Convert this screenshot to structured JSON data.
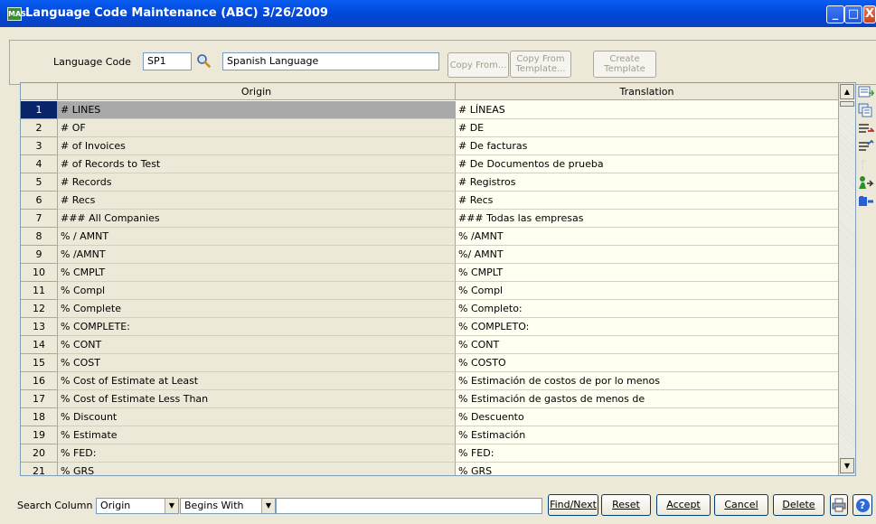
{
  "window": {
    "title": "Language Code Maintenance (ABC) 3/26/2009",
    "app_icon": "MAS",
    "minimize": "_",
    "maximize": "□",
    "close": "X"
  },
  "header": {
    "language_code_label": "Language Code",
    "language_code_value": "SP1",
    "description_value": "Spanish Language",
    "copy_from_label": "Copy From...",
    "copy_from_template_label": "Copy From Template...",
    "create_template_label": "Create Template"
  },
  "grid": {
    "columns": [
      "Origin",
      "Translation"
    ],
    "rows": [
      {
        "num": "1",
        "origin": "# LINES",
        "translation": "# LÍNEAS"
      },
      {
        "num": "2",
        "origin": "# OF",
        "translation": "# DE"
      },
      {
        "num": "3",
        "origin": "# of Invoices",
        "translation": "# De facturas"
      },
      {
        "num": "4",
        "origin": "# of Records to Test",
        "translation": "# De Documentos de prueba"
      },
      {
        "num": "5",
        "origin": "# Records",
        "translation": "# Registros"
      },
      {
        "num": "6",
        "origin": "# Recs",
        "translation": "# Recs"
      },
      {
        "num": "7",
        "origin": "### All Companies",
        "translation": "### Todas las empresas"
      },
      {
        "num": "8",
        "origin": "% / AMNT",
        "translation": "% /AMNT"
      },
      {
        "num": "9",
        "origin": "% /AMNT",
        "translation": "%/ AMNT"
      },
      {
        "num": "10",
        "origin": "% CMPLT",
        "translation": "% CMPLT"
      },
      {
        "num": "11",
        "origin": "% Compl",
        "translation": "% Compl"
      },
      {
        "num": "12",
        "origin": "% Complete",
        "translation": "% Completo:"
      },
      {
        "num": "13",
        "origin": "% COMPLETE:",
        "translation": "% COMPLETO:"
      },
      {
        "num": "14",
        "origin": "% CONT",
        "translation": "% CONT"
      },
      {
        "num": "15",
        "origin": "% COST",
        "translation": "% COSTO"
      },
      {
        "num": "16",
        "origin": "% Cost of Estimate at Least",
        "translation": "% Estimación de costos de por lo menos"
      },
      {
        "num": "17",
        "origin": "% Cost of Estimate Less Than",
        "translation": "% Estimación de gastos de menos de"
      },
      {
        "num": "18",
        "origin": "% Discount",
        "translation": "% Descuento"
      },
      {
        "num": "19",
        "origin": "% Estimate",
        "translation": "% Estimación"
      },
      {
        "num": "20",
        "origin": "% FED:",
        "translation": "% FED:"
      },
      {
        "num": "21",
        "origin": "% GRS",
        "translation": "% GRS"
      }
    ],
    "scroll_up": "▲",
    "scroll_down": "▼"
  },
  "footer": {
    "search_column_label": "Search Column",
    "search_column_value": "Origin",
    "search_mode_value": "Begins With",
    "search_text_value": "",
    "find_next_label": "Find/Next",
    "reset_label": "Reset",
    "accept_label": "Accept",
    "cancel_label": "Cancel",
    "delete_label": "Delete",
    "print_icon": "printer-icon",
    "help_icon": "help-icon",
    "help_glyph": "?"
  },
  "colors": {
    "title_bar": "#0047d5",
    "selected_row_number": "#0a246a",
    "selected_origin": "#a9a9a9",
    "translation_bg": "#fffef0"
  }
}
